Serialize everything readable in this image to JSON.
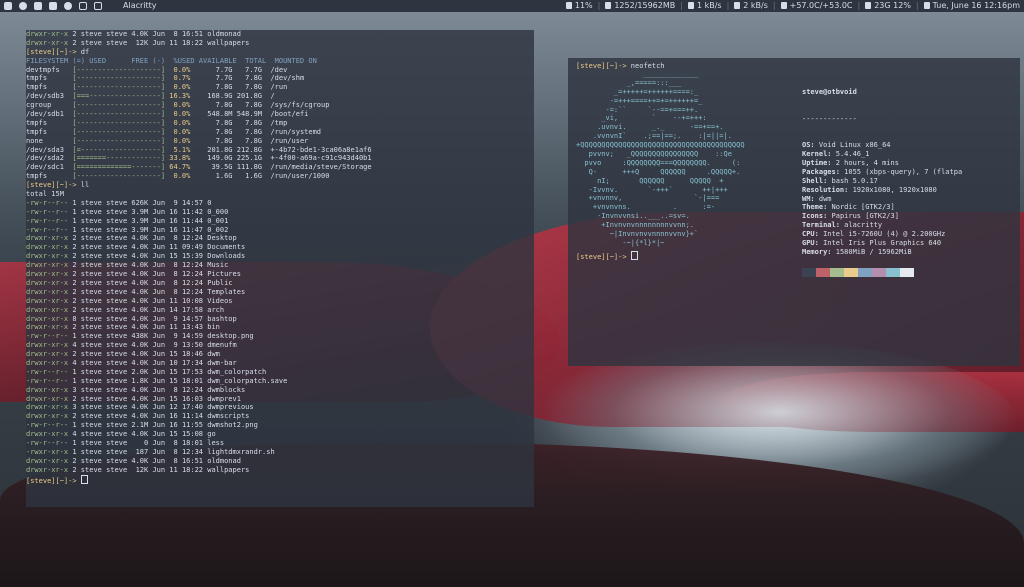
{
  "topbar": {
    "app_title": "Alacritty",
    "status": [
      {
        "icon": "cpu-icon",
        "text": "11%"
      },
      {
        "icon": "memory-icon",
        "text": "1252/15962MB"
      },
      {
        "icon": "download-icon",
        "text": "1 kB/s"
      },
      {
        "icon": "upload-icon",
        "text": "2 kB/s"
      },
      {
        "icon": "temperature-icon",
        "text": "+57.0C/+53.0C"
      },
      {
        "icon": "disk-icon",
        "text": "23G 12%"
      },
      {
        "icon": "clock-icon",
        "text": "Tue, June 16 12:16pm"
      }
    ]
  },
  "terminal_left": {
    "lines": [
      {
        "perm": "drwxr-xr-x",
        "rest": " 2 steve steve 4.0K Jun  8 16:51 oldmonad"
      },
      {
        "perm": "drwxr-xr-x",
        "rest": " 2 steve steve  12K Jun 11 18:22 wallpapers"
      },
      {
        "prompt": "[steve][~]-> ",
        "cmd": "df"
      },
      {
        "hdr": "FILESYSTEM (=) USED      FREE (-)  %USED AVAILABLE  TOTAL  MOUNTED ON"
      },
      {
        "fs": "devtmpfs   ",
        "bar": "[--------------------]",
        "pct": "  0.0%",
        "rest": "      7.7G   7.7G  /dev"
      },
      {
        "fs": "tmpfs      ",
        "bar": "[--------------------]",
        "pct": "  0.7%",
        "rest": "      7.7G   7.8G  /dev/shm"
      },
      {
        "fs": "tmpfs      ",
        "bar": "[--------------------]",
        "pct": "  0.0%",
        "rest": "      7.8G   7.8G  /run"
      },
      {
        "fs": "/dev/sdb3  ",
        "bar": "[===-----------------]",
        "pct": " 16.3%",
        "rest": "    168.9G 201.8G  /"
      },
      {
        "fs": "cgroup     ",
        "bar": "[--------------------]",
        "pct": "  0.0%",
        "rest": "      7.8G   7.8G  /sys/fs/cgroup"
      },
      {
        "fs": "/dev/sdb1  ",
        "bar": "[--------------------]",
        "pct": "  0.0%",
        "rest": "    548.8M 548.9M  /boot/efi"
      },
      {
        "fs": "tmpfs      ",
        "bar": "[--------------------]",
        "pct": "  0.0%",
        "rest": "      7.8G   7.8G  /tmp"
      },
      {
        "fs": "tmpfs      ",
        "bar": "[--------------------]",
        "pct": "  0.0%",
        "rest": "      7.8G   7.8G  /run/systemd"
      },
      {
        "fs": "none       ",
        "bar": "[--------------------]",
        "pct": "  0.0%",
        "rest": "      7.8G   7.8G  /run/user"
      },
      {
        "fs": "/dev/sda3  ",
        "bar": "[=-------------------]",
        "pct": "  5.1%",
        "rest": "    201.8G 212.8G  +-4b72-bde1-3ca06a8e1af6"
      },
      {
        "fs": "/dev/sda2  ",
        "bar": "[=======-------------]",
        "pct": " 33.8%",
        "rest": "    149.0G 225.1G  +-4f00-a69a-c91c943d40b1"
      },
      {
        "fs": "/dev/sdc1  ",
        "bar": "[=============-------]",
        "pct": " 64.7%",
        "rest": "     39.5G 111.8G  /run/media/steve/Storage"
      },
      {
        "fs": "tmpfs      ",
        "bar": "[--------------------]",
        "pct": "  0.0%",
        "rest": "      1.6G   1.6G  /run/user/1000"
      },
      {
        "prompt": "[steve][~]-> ",
        "cmd": "ll"
      },
      {
        "plain": "total 15M"
      },
      {
        "perm": "-rw-r--r--",
        "rest": " 1 steve steve 626K Jun  9 14:57 0"
      },
      {
        "perm": "-rw-r--r--",
        "rest": " 1 steve steve 3.9M Jun 16 11:42 0_000"
      },
      {
        "perm": "-rw-r--r--",
        "rest": " 1 steve steve 3.9M Jun 16 11:44 0_001"
      },
      {
        "perm": "-rw-r--r--",
        "rest": " 1 steve steve 3.9M Jun 16 11:47 0_002"
      },
      {
        "perm": "drwxr-xr-x",
        "rest": " 2 steve steve 4.0K Jun  8 12:24 Desktop"
      },
      {
        "perm": "drwxr-xr-x",
        "rest": " 2 steve steve 4.0K Jun 11 09:49 Documents"
      },
      {
        "perm": "drwxr-xr-x",
        "rest": " 2 steve steve 4.0K Jun 15 15:39 Downloads"
      },
      {
        "perm": "drwxr-xr-x",
        "rest": " 2 steve steve 4.0K Jun  8 12:24 Music"
      },
      {
        "perm": "drwxr-xr-x",
        "rest": " 2 steve steve 4.0K Jun  8 12:24 Pictures"
      },
      {
        "perm": "drwxr-xr-x",
        "rest": " 2 steve steve 4.0K Jun  8 12:24 Public"
      },
      {
        "perm": "drwxr-xr-x",
        "rest": " 2 steve steve 4.0K Jun  8 12:24 Templates"
      },
      {
        "perm": "drwxr-xr-x",
        "rest": " 2 steve steve 4.0K Jun 11 10:08 Videos"
      },
      {
        "perm": "drwxr-xr-x",
        "rest": " 2 steve steve 4.0K Jun 14 17:58 arch"
      },
      {
        "perm": "drwxr-xr-x",
        "rest": " 8 steve steve 4.0K Jun  9 14:57 bashtop"
      },
      {
        "perm": "drwxr-xr-x",
        "rest": " 2 steve steve 4.0K Jun 11 13:43 bin"
      },
      {
        "perm": "-rw-r--r--",
        "rest": " 1 steve steve 438K Jun  9 14:59 desktop.png"
      },
      {
        "perm": "drwxr-xr-x",
        "rest": " 4 steve steve 4.0K Jun  9 13:50 dmenufm"
      },
      {
        "perm": "drwxr-xr-x",
        "rest": " 2 steve steve 4.0K Jun 15 18:46 dwm"
      },
      {
        "perm": "drwxr-xr-x",
        "rest": " 4 steve steve 4.0K Jun 10 17:34 dwm-bar"
      },
      {
        "perm": "-rw-r--r--",
        "rest": " 1 steve steve 2.0K Jun 15 17:53 dwm_colorpatch"
      },
      {
        "perm": "-rw-r--r--",
        "rest": " 1 steve steve 1.8K Jun 15 18:01 dwm_colorpatch.save"
      },
      {
        "perm": "drwxr-xr-x",
        "rest": " 3 steve steve 4.0K Jun  8 12:24 dwmblocks"
      },
      {
        "perm": "drwxr-xr-x",
        "rest": " 2 steve steve 4.0K Jun 15 16:03 dwmprev1"
      },
      {
        "perm": "drwxr-xr-x",
        "rest": " 3 steve steve 4.0K Jun 12 17:40 dwmprevious"
      },
      {
        "perm": "drwxr-xr-x",
        "rest": " 2 steve steve 4.0K Jun 16 11:14 dwmscripts"
      },
      {
        "perm": "-rw-r--r--",
        "rest": " 1 steve steve 2.1M Jun 16 11:55 dwmshot2.png"
      },
      {
        "perm": "drwxr-xr-x",
        "rest": " 4 steve steve 4.0K Jun 15 15:08 go"
      },
      {
        "perm": "-rw-r--r--",
        "rest": " 1 steve steve    0 Jun  8 18:01 less"
      },
      {
        "perm": "-rwxr-xr-x",
        "rest": " 1 steve steve  187 Jun  8 12:34 lightdmxrandr.sh"
      },
      {
        "perm": "drwxr-xr-x",
        "rest": " 2 steve steve 4.0K Jun  8 16:51 oldmonad"
      },
      {
        "perm": "drwxr-xr-x",
        "rest": " 2 steve steve  12K Jun 11 18:22 wallpapers"
      },
      {
        "prompt": "[steve][~]-> ",
        "cmd": "",
        "cursor": true
      }
    ]
  },
  "terminal_right": {
    "prompt": "[steve][~]-> ",
    "command": "neofetch",
    "logo": [
      "                _____________",
      "            _,=====:::___",
      "         _=+++++=++++++====:_",
      "        -=+++====++=+=++++++=_",
      "       -=:``     `--==+===++.",
      "      _vi,        `    --+=+++:",
      "     .uvnvi.      _._      -==+==+.",
      "    .vvnvnI`    .;==|==;.    :|=||=|.",
      "+QQQQQQQQQQQQQQQQQQQQQQQQQQQQQQQQQQQQQQQ",
      "   pvvnv;   _QQQQQQQQQQQQQQQQ    ::Qe",
      "  pvvo     :QQQQQQQQ===QQQQQQQQ.     (:",
      "   Q-      +++Q     QQQQQQ     .QQQQQ+.",
      "     nI;       QQQQQQ      QQQQQ  +",
      "   -Ivvnv.       `-+++`       ++|+++",
      "   +vnvnnv,                 `-|===",
      "    +vnvnvns.          .      :=-",
      "     -Invnvvnsi..___..=sv=.",
      "      +Invnvnvnnnnnnnnvvnn;.",
      "        ~|Invnvnvvnnnnvvnv}+`",
      "           -~|{*l}*|~"
    ],
    "host": "steve@otbvoid",
    "separator": "-------------",
    "info": [
      {
        "key": "OS:",
        "val": " Void Linux x86_64"
      },
      {
        "key": "Kernel:",
        "val": " 5.4.46_1"
      },
      {
        "key": "Uptime:",
        "val": " 2 hours, 4 mins"
      },
      {
        "key": "Packages:",
        "val": " 1055 (xbps-query), 7 (flatpa"
      },
      {
        "key": "Shell:",
        "val": " bash 5.0.17"
      },
      {
        "key": "Resolution:",
        "val": " 1920x1080, 1920x1080"
      },
      {
        "key": "WM:",
        "val": " dwm"
      },
      {
        "key": "Theme:",
        "val": " Nordic [GTK2/3]"
      },
      {
        "key": "Icons:",
        "val": " Papirus [GTK2/3]"
      },
      {
        "key": "Terminal:",
        "val": " alacritty"
      },
      {
        "key": "CPU:",
        "val": " Intel i5-7260U (4) @ 2.200GHz"
      },
      {
        "key": "GPU:",
        "val": " Intel Iris Plus Graphics 640"
      },
      {
        "key": "Memory:",
        "val": " 1580MiB / 15962MiB"
      }
    ],
    "palette": [
      "#3b4252",
      "#bf616a",
      "#a3be8c",
      "#ebcb8b",
      "#81a1c1",
      "#b48ead",
      "#88c0d0",
      "#e5e9f0"
    ],
    "end_prompt": "[steve][~]-> "
  }
}
